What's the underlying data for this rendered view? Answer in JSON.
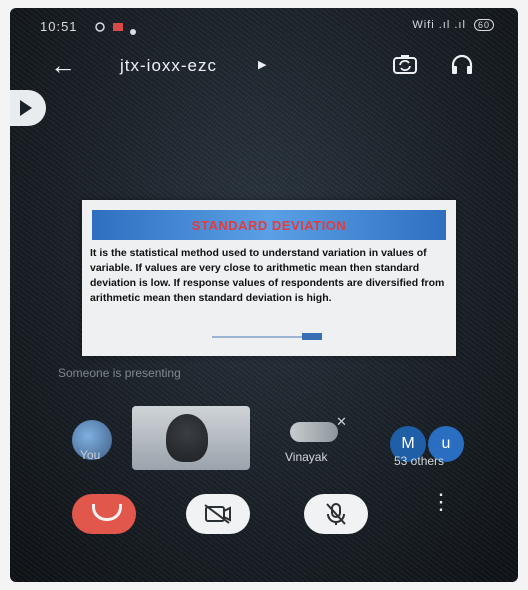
{
  "status_bar": {
    "time": "10:51",
    "right_text": "Wifi .ıl .ıl",
    "battery": "60"
  },
  "app_bar": {
    "meeting_code": "jtx-ioxx-ezc"
  },
  "slide": {
    "title": "STANDARD DEVIATION",
    "body": "It is the statistical method used to understand variation in values of variable. If values are very close to arithmetic mean then standard deviation is low. If response values of respondents are diversified from arithmetic mean then standard deviation is high."
  },
  "presenting_label": "Someone is presenting",
  "participants": {
    "p1_name": "You",
    "p3_name": "Vinayak",
    "others_initial_1": "M",
    "others_initial_2": "u",
    "others_count": "53 others"
  },
  "icons": {
    "back": "arrow-left-icon",
    "camera_switch": "camera-switch-icon",
    "audio": "headphones-icon",
    "end_call": "phone-hangup-icon",
    "camera_off": "camera-off-icon",
    "mic_off": "mic-off-icon",
    "more": "more-vert-icon"
  },
  "colors": {
    "end_call": "#e2574c",
    "avatar_blue": "#1f5fa8",
    "slide_title": "#e43c3c",
    "slide_banner": "#2f6fc0"
  }
}
